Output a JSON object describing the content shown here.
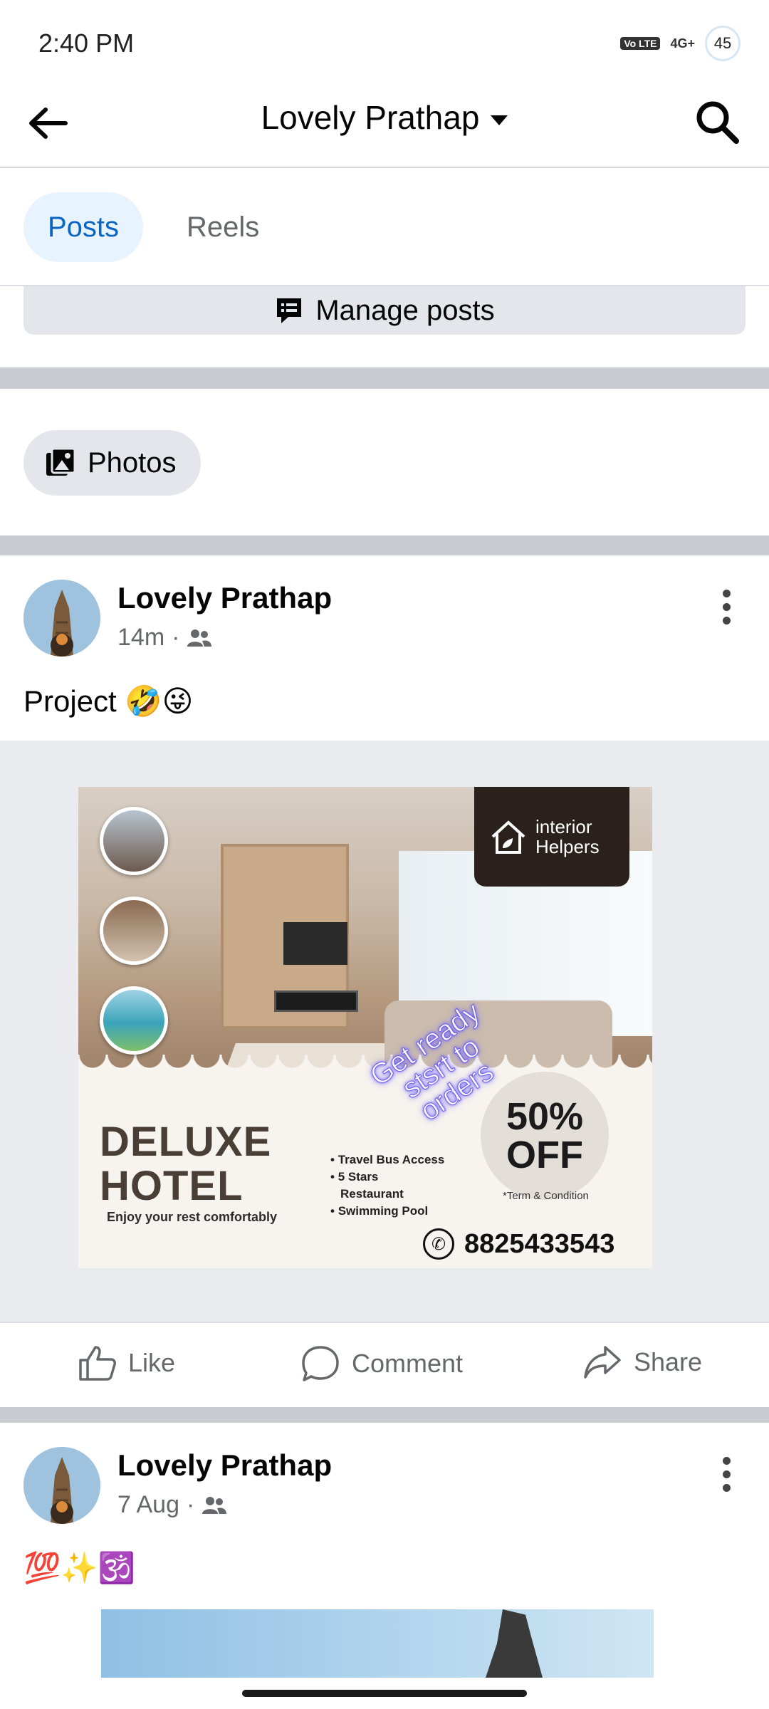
{
  "status_bar": {
    "time": "2:40 PM",
    "volte": "Vo LTE",
    "network": "4G+",
    "battery": "45"
  },
  "app_bar": {
    "title": "Lovely Prathap"
  },
  "tabs": [
    {
      "label": "Posts",
      "active": true
    },
    {
      "label": "Reels",
      "active": false
    }
  ],
  "manage_posts_label": "Manage posts",
  "photos_chip_label": "Photos",
  "posts": [
    {
      "author": "Lovely Prathap",
      "time": "14m",
      "text": "Project 🤣😜",
      "ad": {
        "brand_line1": "interior",
        "brand_line2": "Helpers",
        "tagline": "Get ready stsrt to orders",
        "offer_line1": "50%",
        "offer_line2": "OFF",
        "title_line1": "DELUXE",
        "title_line2": "HOTEL",
        "subtitle": "Enjoy your rest comfortably",
        "features": [
          "Travel Bus Access",
          "5 Stars",
          "Restaurant",
          "Swimming Pool"
        ],
        "terms": "*Term & Condition",
        "phone": "8825433543"
      }
    },
    {
      "author": "Lovely Prathap",
      "time": "7 Aug",
      "text": "💯✨🕉️"
    }
  ],
  "actions": {
    "like": "Like",
    "comment": "Comment",
    "share": "Share"
  },
  "colors": {
    "accent": "#0a66c2",
    "active_tab_bg": "#e7f3ff",
    "divider": "#c9ccd1",
    "secondary_text": "#65676b"
  }
}
